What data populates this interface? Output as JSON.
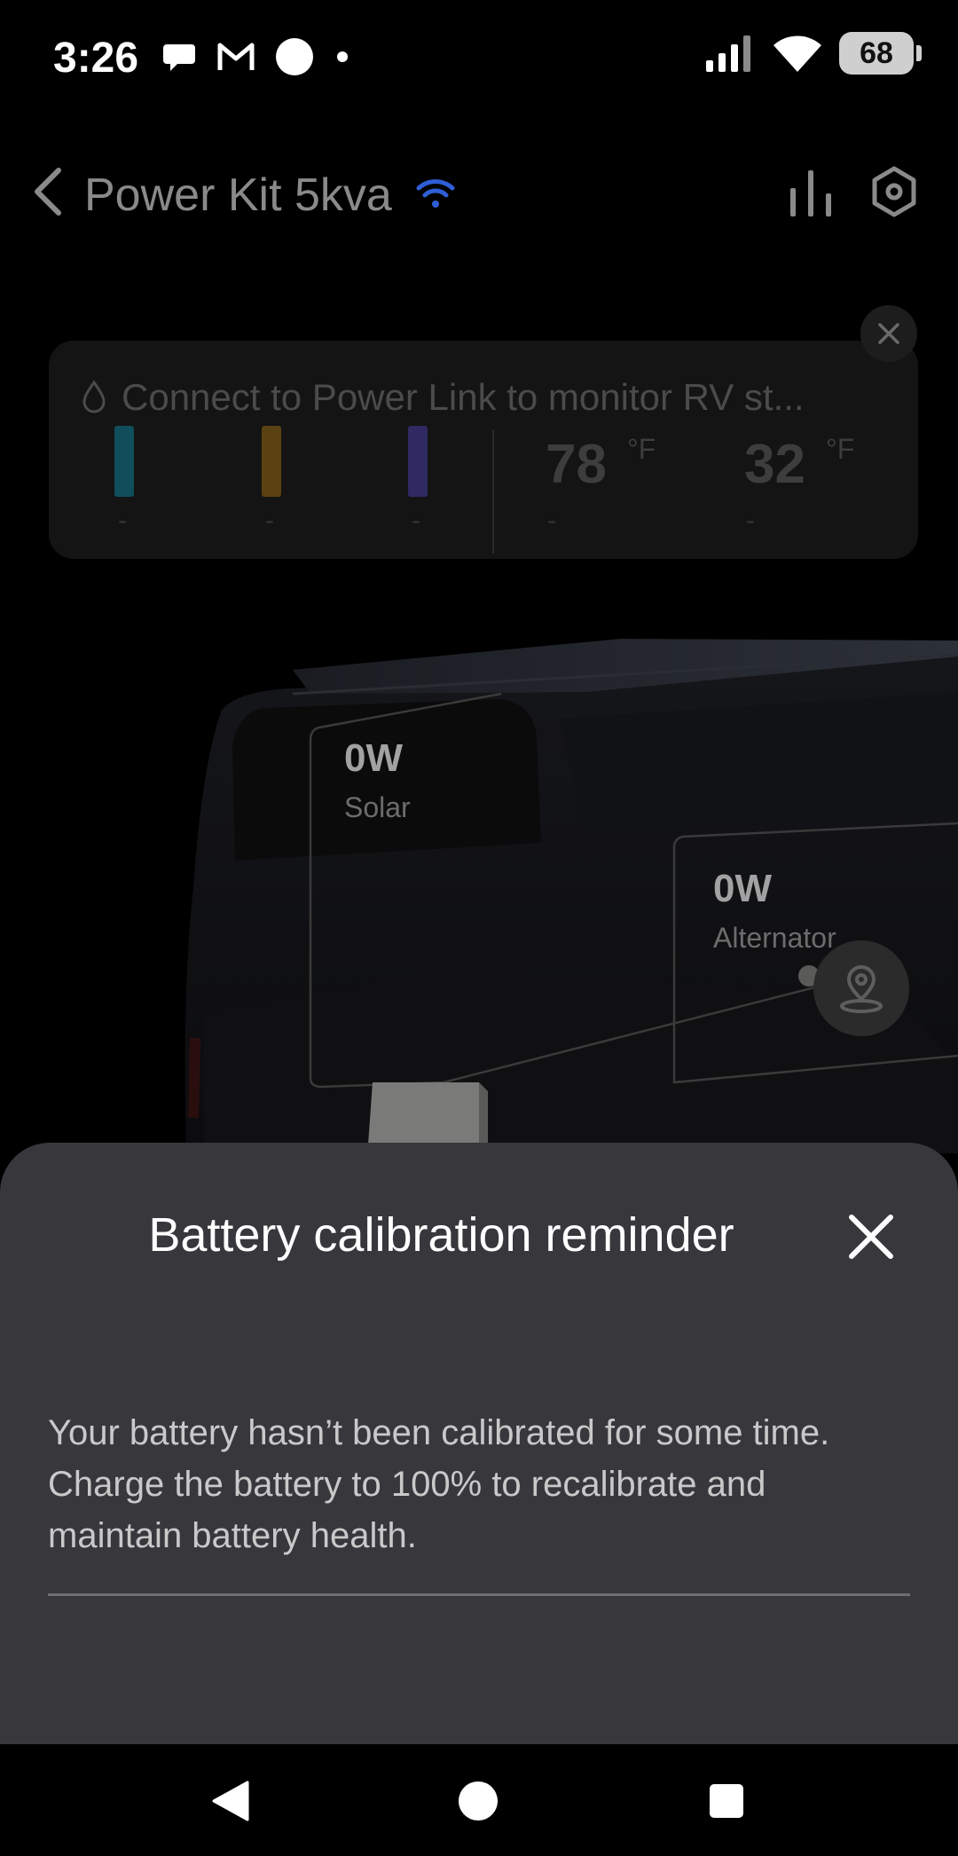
{
  "status_bar": {
    "time": "3:26",
    "battery_level": "68",
    "left_icons": [
      "chat-bubble-icon",
      "gmail-icon",
      "circle-icon",
      "dot-icon"
    ],
    "right_icons": [
      "signal-icon",
      "wifi-icon",
      "battery-icon"
    ]
  },
  "header": {
    "title": "Power Kit 5kva",
    "connection_icon": "wifi-icon",
    "accent_color": "#2f5fd6"
  },
  "monitor_card": {
    "title": "Connect to Power Link to monitor RV st...",
    "gauges": [
      {
        "color": "#0f4e5a",
        "value": "-"
      },
      {
        "color": "#5b4212",
        "value": "-"
      },
      {
        "color": "#2f2a62",
        "value": "-"
      }
    ],
    "temperatures": [
      {
        "value": "78",
        "unit": "°F",
        "sub": "-"
      },
      {
        "value": "32",
        "unit": "°F",
        "sub": "-"
      }
    ]
  },
  "readings": {
    "solar": {
      "value": "0W",
      "label": "Solar"
    },
    "alternator": {
      "value": "0W",
      "label": "Alternator"
    }
  },
  "sheet": {
    "title": "Battery calibration reminder",
    "body": "Your battery hasn’t been calibrated for some time. Charge the battery to 100% to recalibrate and maintain battery health."
  },
  "nav": {
    "back": "back-triangle-icon",
    "home": "home-circle-icon",
    "recents": "recents-square-icon"
  }
}
